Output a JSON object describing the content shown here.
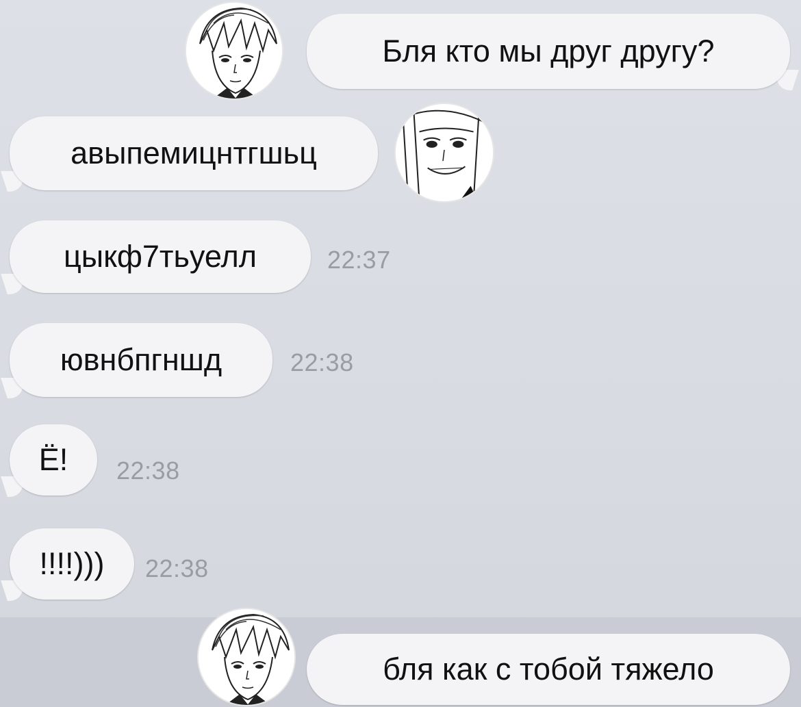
{
  "messages": [
    {
      "text": "Бля кто мы друг другу?",
      "direction": "outgoing"
    },
    {
      "text": "авыпемицнтгшьц",
      "direction": "incoming"
    },
    {
      "text": "цыкф7тьуелл",
      "time": "22:37",
      "direction": "incoming"
    },
    {
      "text": "ювнбпгншд",
      "time": "22:38",
      "direction": "incoming"
    },
    {
      "text": "Ё!",
      "time": "22:38",
      "direction": "incoming"
    },
    {
      "text": "!!!!)))",
      "time": "22:38",
      "direction": "incoming"
    },
    {
      "text": "бля как с тобой тяжело",
      "direction": "outgoing"
    }
  ],
  "avatars": [
    "manga-boy-avatar",
    "manga-smiling-avatar",
    "manga-boy-avatar"
  ],
  "colors": {
    "bubble": "#f4f4f6",
    "background": "#dde0e7",
    "time": "#9a9ca4"
  }
}
